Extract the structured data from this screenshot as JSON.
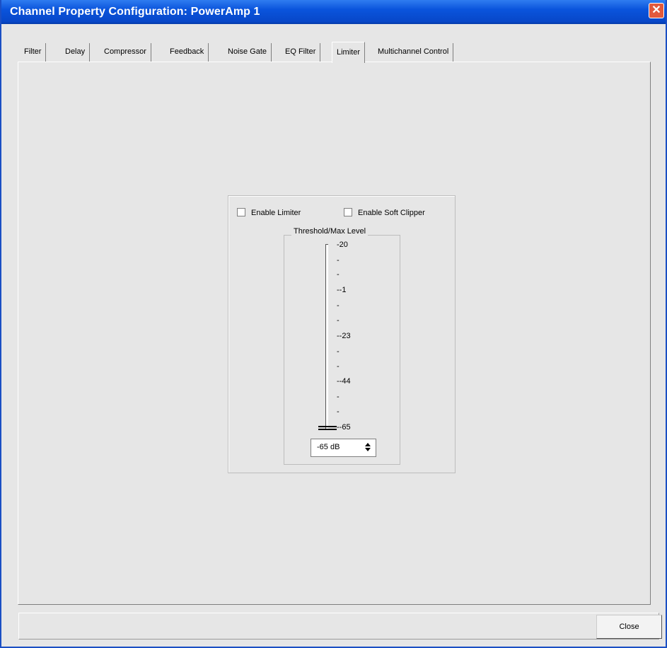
{
  "window": {
    "title": "Channel Property Configuration: PowerAmp 1",
    "close_glyph": "✕"
  },
  "tabs": [
    {
      "label": "Filter"
    },
    {
      "label": "Delay"
    },
    {
      "label": "Compressor"
    },
    {
      "label": "Feedback"
    },
    {
      "label": "Noise Gate"
    },
    {
      "label": "EQ Filter"
    },
    {
      "label": "Limiter",
      "active": true
    },
    {
      "label": "Multichannel Control"
    }
  ],
  "limiter": {
    "enable_limiter_label": "Enable Limiter",
    "enable_limiter_checked": false,
    "enable_soft_clipper_label": "Enable Soft Clipper",
    "enable_soft_clipper_checked": false,
    "threshold_group_label": "Threshold/Max Level",
    "scale_ticks": [
      "-20",
      "-",
      "-",
      "--1",
      "-",
      "-",
      "--23",
      "-",
      "-",
      "--44",
      "-",
      "-",
      "--65"
    ],
    "slider_value": -65,
    "spinner_value": "-65 dB"
  },
  "footer": {
    "close_label": "Close"
  }
}
